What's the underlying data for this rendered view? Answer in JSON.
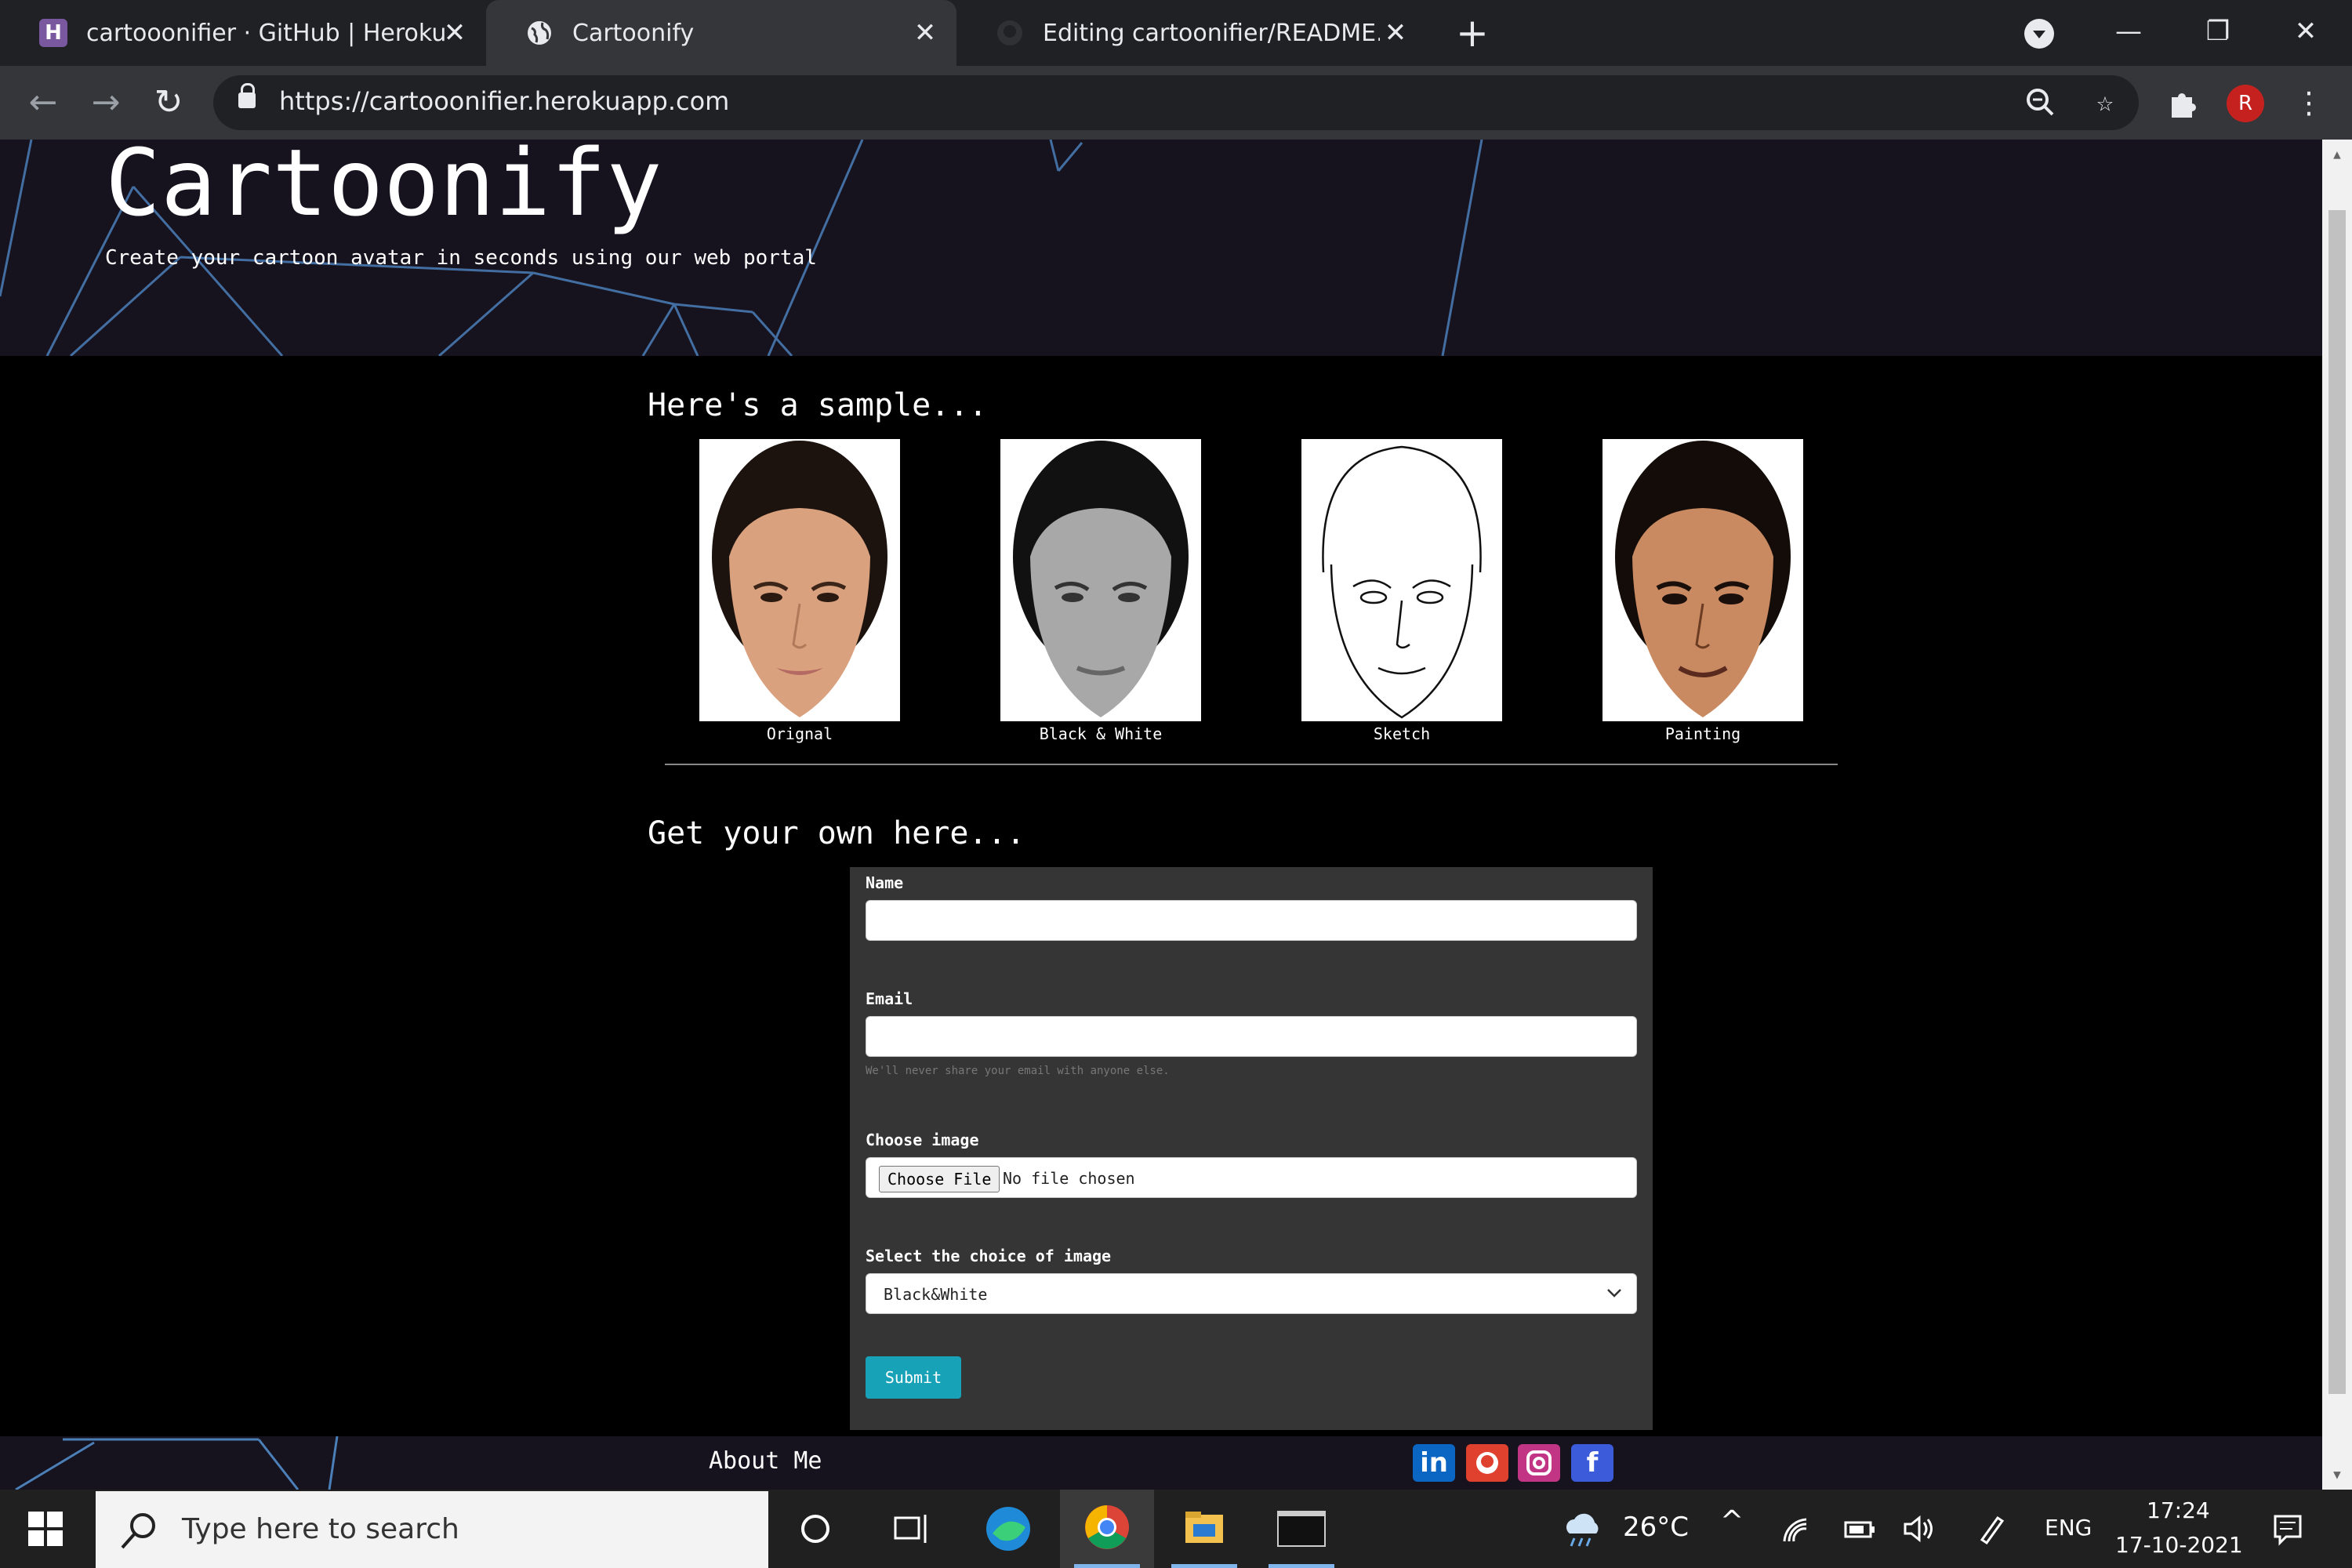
{
  "browser": {
    "tabs": [
      {
        "title": "cartooonifier · GitHub | Heroku",
        "icon": "heroku-icon"
      },
      {
        "title": "Cartoonify",
        "icon": "globe-icon"
      },
      {
        "title": "Editing cartoonifier/README.md",
        "icon": "github-icon"
      }
    ],
    "url": "https://cartooonifier.herokuapp.com",
    "profile_initial": "R"
  },
  "hero": {
    "title": "Cartoonify",
    "subtitle": "Create your cartoon avatar in seconds using our web portal"
  },
  "samples": {
    "heading": "Here's a sample...",
    "items": [
      {
        "caption": "Orignal"
      },
      {
        "caption": "Black & White"
      },
      {
        "caption": "Sketch"
      },
      {
        "caption": "Painting"
      }
    ]
  },
  "form": {
    "heading": "Get your own here...",
    "name_label": "Name",
    "name_value": "",
    "email_label": "Email",
    "email_value": "",
    "email_help": "We'll never share your email with anyone else.",
    "image_label": "Choose image",
    "file_button": "Choose File",
    "file_status": "No file chosen",
    "choice_label": "Select the choice of image",
    "choice_selected": "Black&White",
    "submit_label": "Submit"
  },
  "footer": {
    "about_label": "About Me",
    "social": [
      {
        "icon": "linkedin-icon",
        "glyph": "in",
        "color": "#0a66c2"
      },
      {
        "icon": "github-icon",
        "glyph": "",
        "color": "#e0402e"
      },
      {
        "icon": "instagram-icon",
        "glyph": "",
        "color": "#c13584"
      },
      {
        "icon": "facebook-icon",
        "glyph": "f",
        "color": "#3b5bdb"
      }
    ]
  },
  "taskbar": {
    "search_placeholder": "Type here to search",
    "weather": "26°C",
    "language": "ENG",
    "time": "17:24",
    "date": "17-10-2021"
  }
}
